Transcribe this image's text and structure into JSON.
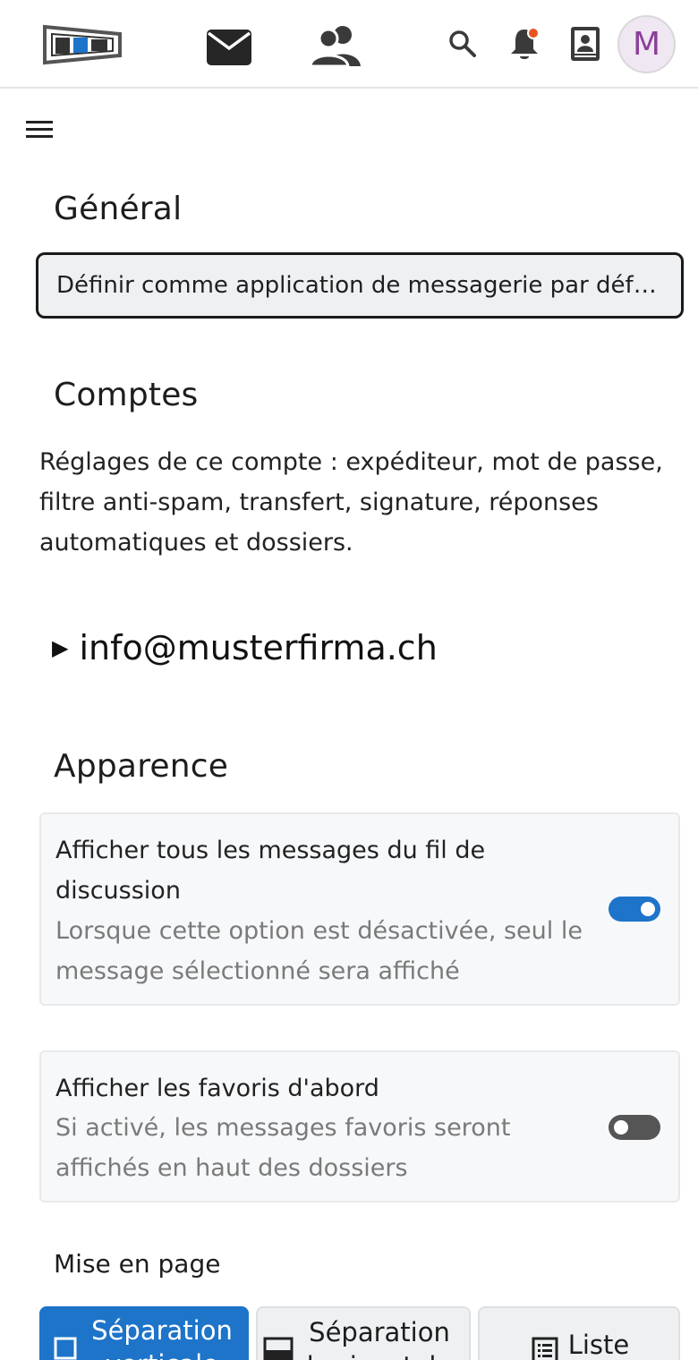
{
  "header": {
    "logo_icon": "app-logo-icon",
    "mail_icon": "mail-icon",
    "contacts_icon": "contacts-icon",
    "search_icon": "search-icon",
    "notifications_icon": "bell-icon",
    "address_book_icon": "address-book-icon",
    "avatar_initial": "M",
    "notification_dot_color": "#e9541e"
  },
  "general": {
    "title": "Général",
    "default_app_button": "Définir comme application de messagerie par défaut"
  },
  "accounts": {
    "title": "Comptes",
    "description": "Réglages de ce compte : expéditeur, mot de passe, filtre anti-spam, transfert, signature, réponses automatiques et dossiers.",
    "account_email": "info@musterfirma.ch"
  },
  "appearance": {
    "title": "Apparence",
    "thread_option": {
      "title": "Afficher tous les messages du fil de discussion",
      "subtitle": "Lorsque cette option est désactivée, seul le message sélectionné sera affiché",
      "enabled": true
    },
    "favorites_option": {
      "title": "Afficher les favoris d'abord",
      "subtitle": "Si activé, les messages favoris seront affichés en haut des dossiers",
      "enabled": false
    },
    "layout_label": "Mise en page",
    "layout_options": [
      {
        "label": "Séparation verticale",
        "icon": "vertical-split-icon",
        "selected": true
      },
      {
        "label": "Séparation horizontale",
        "icon": "horizontal-split-icon",
        "selected": false
      },
      {
        "label": "Liste",
        "icon": "list-icon",
        "selected": false
      }
    ]
  },
  "colors": {
    "accent": "#1d74c9",
    "toggle_off": "#555555"
  }
}
